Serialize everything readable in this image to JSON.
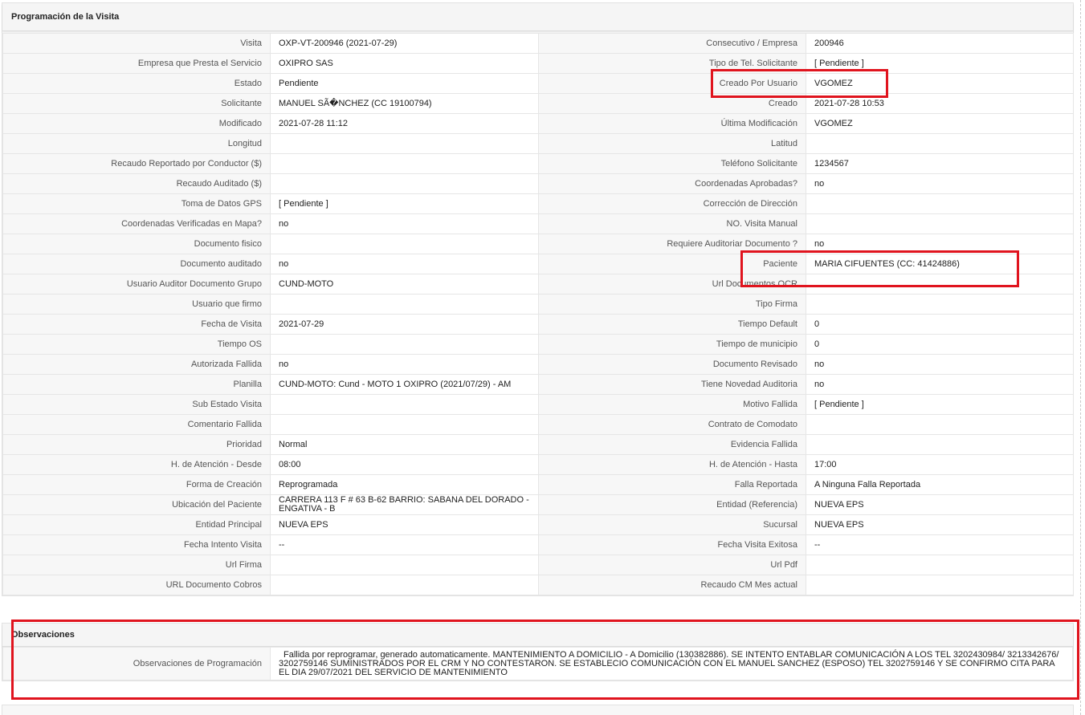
{
  "panel": {
    "title": "Programación de la Visita",
    "rows": [
      {
        "l1": "Visita",
        "v1": "OXP-VT-200946 (2021-07-29)",
        "l2": "Consecutivo / Empresa",
        "v2": "200946"
      },
      {
        "l1": "Empresa que Presta el Servicio",
        "v1": "OXIPRO SAS",
        "l2": "Tipo de Tel. Solicitante",
        "v2": "[ Pendiente ]"
      },
      {
        "l1": "Estado",
        "v1": "Pendiente",
        "l2": "Creado Por Usuario",
        "v2": "VGOMEZ"
      },
      {
        "l1": "Solicitante",
        "v1": "MANUEL SÃ�NCHEZ (CC 19100794)",
        "l2": "Creado",
        "v2": "2021-07-28 10:53"
      },
      {
        "l1": "Modificado",
        "v1": "2021-07-28 11:12",
        "l2": "Última Modificación",
        "v2": " VGOMEZ"
      },
      {
        "l1": "Longitud",
        "v1": "",
        "l2": "Latitud",
        "v2": ""
      },
      {
        "l1": "Recaudo Reportado por Conductor ($)",
        "v1": "",
        "l2": "Teléfono Solicitante",
        "v2": "1234567"
      },
      {
        "l1": "Recaudo Auditado ($)",
        "v1": "",
        "l2": "Coordenadas Aprobadas?",
        "v2": " no"
      },
      {
        "l1": "Toma de Datos GPS",
        "v1": "[ Pendiente ]",
        "l2": "Corrección de Dirección",
        "v2": ""
      },
      {
        "l1": "Coordenadas Verificadas en Mapa?",
        "v1": " no",
        "l2": "NO. Visita Manual",
        "v2": ""
      },
      {
        "l1": "Documento fisico",
        "v1": "",
        "l2": "Requiere Auditoriar Documento ?",
        "v2": " no"
      },
      {
        "l1": "Documento auditado",
        "v1": " no",
        "l2": "Paciente",
        "v2": "MARIA CIFUENTES (CC: 41424886)"
      },
      {
        "l1": "Usuario Auditor Documento Grupo",
        "v1": "CUND-MOTO",
        "l2": "Url Documentos OCR",
        "v2": ""
      },
      {
        "l1": "Usuario que firmo",
        "v1": "",
        "l2": "Tipo Firma",
        "v2": ""
      },
      {
        "l1": "Fecha de Visita",
        "v1": " 2021-07-29",
        "l2": "Tiempo Default",
        "v2": "0"
      },
      {
        "l1": "Tiempo OS",
        "v1": "",
        "l2": "Tiempo de municipio",
        "v2": "0"
      },
      {
        "l1": "Autorizada Fallida",
        "v1": " no",
        "l2": "Documento Revisado",
        "v2": " no"
      },
      {
        "l1": "Planilla",
        "v1": "CUND-MOTO: Cund - MOTO 1 OXIPRO (2021/07/29) - AM",
        "l2": "Tiene Novedad Auditoria",
        "v2": " no"
      },
      {
        "l1": "Sub Estado Visita",
        "v1": "",
        "l2": "Motivo Fallida",
        "v2": "[ Pendiente ]"
      },
      {
        "l1": "Comentario Fallida",
        "v1": "",
        "l2": "Contrato de Comodato",
        "v2": ""
      },
      {
        "l1": "Prioridad",
        "v1": "Normal",
        "l2": "Evidencia Fallida",
        "v2": ""
      },
      {
        "l1": "H. de Atención - Desde",
        "v1": "08:00",
        "l2": "H. de Atención - Hasta",
        "v2": "17:00"
      },
      {
        "l1": "Forma de Creación",
        "v1": "Reprogramada",
        "l2": "Falla Reportada",
        "v2": "A Ninguna Falla Reportada"
      },
      {
        "l1": "Ubicación del Paciente",
        "v1": "CARRERA 113 F # 63 B-62 BARRIO: SABANA DEL DORADO - ENGATIVA - B",
        "l2": "Entidad (Referencia)",
        "v2": "NUEVA EPS"
      },
      {
        "l1": "Entidad Principal",
        "v1": "NUEVA EPS",
        "l2": "Sucursal",
        "v2": "NUEVA EPS"
      },
      {
        "l1": "Fecha Intento Visita",
        "v1": " --",
        "l2": "Fecha Visita Exitosa",
        "v2": " --"
      },
      {
        "l1": "Url Firma",
        "v1": "",
        "l2": "Url Pdf",
        "v2": ""
      },
      {
        "l1": "URL Documento Cobros",
        "v1": "",
        "l2": "Recaudo CM Mes actual",
        "v2": ""
      }
    ]
  },
  "observaciones": {
    "title": "Observaciones",
    "label": "Observaciones de Programación",
    "text": "Fallida por reprogramar, generado automaticamente. MANTENIMIENTO A DOMICILIO - A Domicilio (130382886). SE INTENTO ENTABLAR COMUNICACIÓN A LOS TEL 3202430984/ 3213342676/ 3202759146 SUMINISTRADOS POR EL CRM Y NO CONTESTARON. SE ESTABLECIO COMUNICACIÓN CON EL MANUEL SANCHEZ (ESPOSO) TEL 3202759146 Y SE CONFIRMO CITA PARA EL DIA 29/07/2021 DEL SERVICIO DE MANTENIMIENTO"
  },
  "highlight_color": "#e0141e"
}
